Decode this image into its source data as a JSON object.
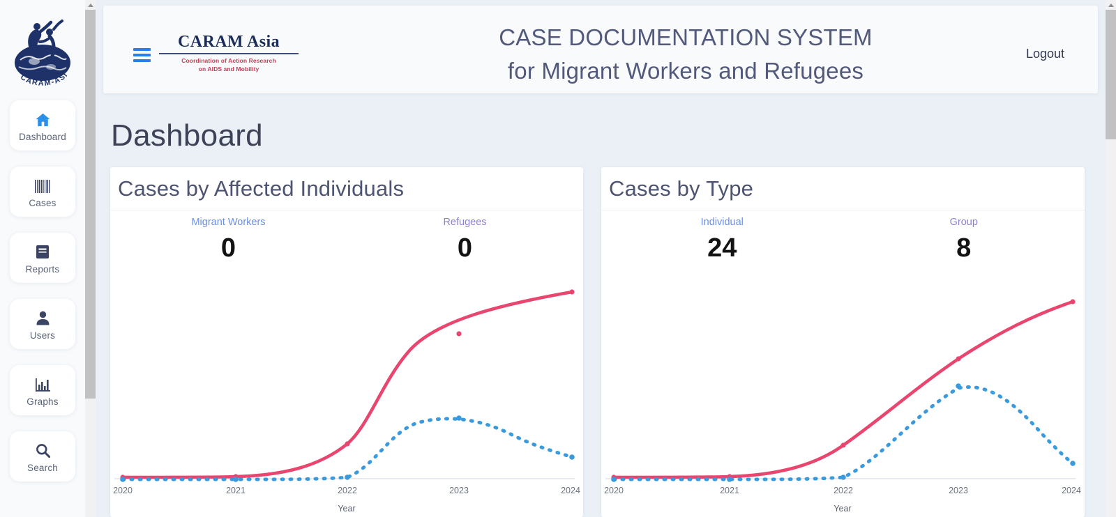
{
  "sidebar": {
    "logo_alt": "CARAM-ASIA",
    "items": [
      {
        "label": "Dashboard",
        "icon": "home-icon",
        "active": true
      },
      {
        "label": "Cases",
        "icon": "barcode-icon",
        "active": false
      },
      {
        "label": "Reports",
        "icon": "book-icon",
        "active": false
      },
      {
        "label": "Users",
        "icon": "user-icon",
        "active": false
      },
      {
        "label": "Graphs",
        "icon": "bar-chart-icon",
        "active": false
      },
      {
        "label": "Search",
        "icon": "magnifier-icon",
        "active": false
      }
    ]
  },
  "header": {
    "menu_icon": "hamburger-icon",
    "logo_title": "CARAM Asia",
    "logo_tagline_line1": "Coordination of Action Research",
    "logo_tagline_line2": "on AIDS and Mobility",
    "title_line1": "CASE DOCUMENTATION SYSTEM",
    "title_line2": "for Migrant Workers and Refugees",
    "logout_label": "Logout"
  },
  "page": {
    "title": "Dashboard"
  },
  "colors": {
    "page_background": "#eaf0f6",
    "card_background": "#ffffff",
    "title_text": "#52597a",
    "accent_blue": "#2b7de9",
    "series_pink": "#e8466f",
    "series_blue": "#3a9ade",
    "stat_label_blue": "#6d8ee0",
    "stat_label_purple": "#8b82d6",
    "logo_navy": "#1c2d5a",
    "logo_red": "#c0415a"
  },
  "cards": [
    {
      "title": "Cases by Affected Individuals",
      "stats": [
        {
          "label": "Migrant Workers",
          "value": "0",
          "color": "#6d8ee0"
        },
        {
          "label": "Refugees",
          "value": "0",
          "color": "#8b82d6"
        }
      ]
    },
    {
      "title": "Cases by Type",
      "stats": [
        {
          "label": "Individual",
          "value": "24",
          "color": "#6d8ee0"
        },
        {
          "label": "Group",
          "value": "8",
          "color": "#8b82d6"
        }
      ]
    }
  ],
  "chart_data": [
    {
      "type": "line",
      "title": "Cases by Affected Individuals",
      "xlabel": "Year",
      "ylabel": "",
      "categories": [
        "2020",
        "2021",
        "2022",
        "2023",
        "2024"
      ],
      "x": [
        2020,
        2021,
        2022,
        2023,
        2024
      ],
      "xlim": [
        2020,
        2024
      ],
      "ylim": [
        0,
        100
      ],
      "grid": false,
      "legend": "none",
      "series": [
        {
          "name": "Migrant Workers",
          "color": "#e8466f",
          "style": "solid",
          "markers": true,
          "values": [
            0,
            0,
            5,
            68,
            95
          ]
        },
        {
          "name": "Refugees",
          "color": "#3a9ade",
          "style": "dotted",
          "markers": true,
          "values": [
            0,
            0,
            0,
            27,
            13
          ]
        }
      ]
    },
    {
      "type": "line",
      "title": "Cases by Type",
      "xlabel": "Year",
      "ylabel": "",
      "categories": [
        "2020",
        "2021",
        "2022",
        "2023",
        "2024"
      ],
      "x": [
        2020,
        2021,
        2022,
        2023,
        2024
      ],
      "xlim": [
        2020,
        2024
      ],
      "ylim": [
        0,
        100
      ],
      "grid": false,
      "legend": "none",
      "series": [
        {
          "name": "Individual",
          "color": "#e8466f",
          "style": "solid",
          "markers": true,
          "values": [
            0,
            0,
            5,
            47,
            92
          ]
        },
        {
          "name": "Group",
          "color": "#3a9ade",
          "style": "dotted",
          "markers": true,
          "values": [
            0,
            0,
            0,
            41,
            9
          ]
        }
      ]
    }
  ]
}
